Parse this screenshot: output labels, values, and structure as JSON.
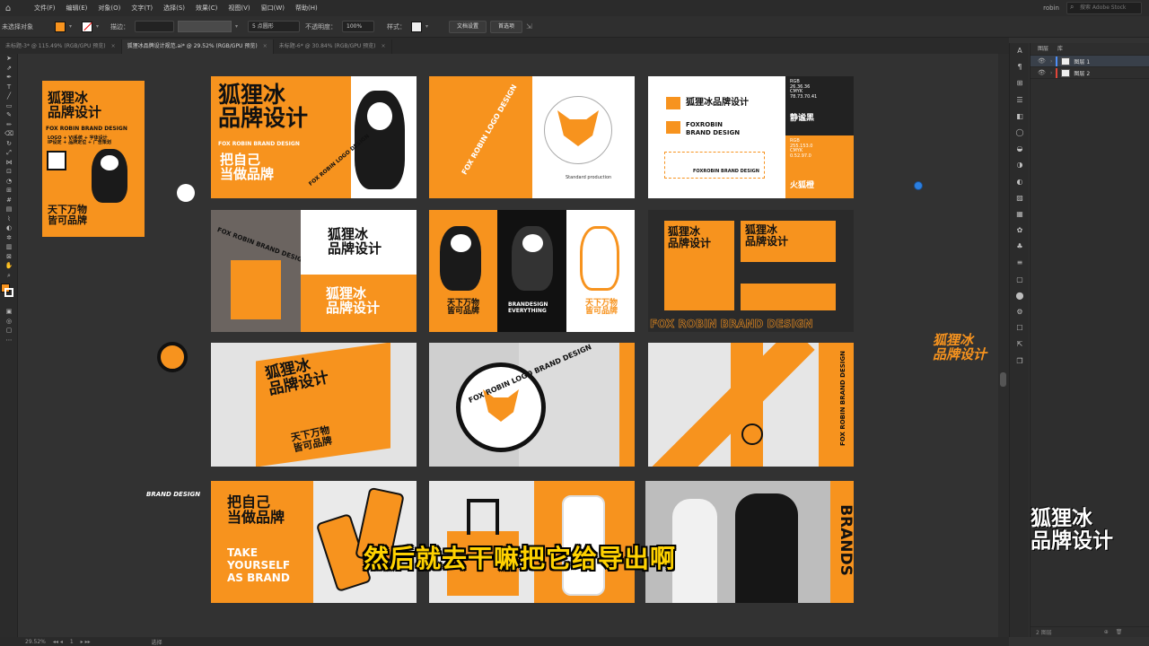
{
  "menubar": {
    "items": [
      "文件(F)",
      "编辑(E)",
      "对象(O)",
      "文字(T)",
      "选择(S)",
      "效果(C)",
      "视图(V)",
      "窗口(W)",
      "帮助(H)"
    ],
    "search_placeholder": "搜索 Adobe Stock",
    "user": "robin"
  },
  "controlbar": {
    "no_selection": "未选择对象",
    "stroke_label": "描边：",
    "stroke_value": "",
    "brush_value": "5 点圆形",
    "opacity_label": "不透明度：",
    "opacity_value": "100%",
    "style_label": "样式：",
    "doc_setup": "文档设置",
    "prefs": "首选项",
    "fill_color": "#f7931e"
  },
  "tabs": [
    {
      "label": "未标题-3* @ 115.49% (RGB/GPU 预览)",
      "active": false
    },
    {
      "label": "狐狸冰品牌设计规范.ai* @ 29.52% (RGB/GPU 预览)",
      "active": true
    },
    {
      "label": "未标题-6* @ 30.84% (RGB/GPU 预览)",
      "active": false
    }
  ],
  "layers_panel": {
    "tab_layers": "图层",
    "tab_libs": "库",
    "layers": [
      {
        "name": "图层 1",
        "color": "#4f8ff7",
        "selected": true
      },
      {
        "name": "图层 2",
        "color": "#e0453a",
        "selected": false
      }
    ],
    "footer_count": "2 图层"
  },
  "status": {
    "zoom": "29.52%",
    "page": "1",
    "tool": "选择"
  },
  "artwork": {
    "poster_title": "狐狸冰\n品牌设计",
    "poster_en": "FOX ROBIN BRAND DESIGN",
    "poster_services": "LOGO + VI系统 + 字体设计\nIP设定 + 品牌定位 + 广告策划",
    "poster_slogan": "天下万物\n皆可品牌",
    "banner_title": "狐狸冰\n品牌设计",
    "banner_en": "FOX ROBIN BRAND DESIGN",
    "banner_slogan": "把自己\n当做品牌",
    "logo_ring_text": "FOX ROBIN LOGO DESIGN",
    "standard": "Standard production",
    "vi_cn": "狐狸冰品牌设计",
    "vi_en1": "FOXROBIN",
    "vi_en2": "BRAND DESIGN",
    "vi_en3": "FOXROBIN BRAND DESIGN",
    "color1_name": "静谧黑",
    "color1_vals": "RGB\n26.36.36\nCMYK\n78.73.70.41",
    "color2_name": "火狐橙",
    "color2_vals": "RGB\n255.153.0\nCMYK\n0.52.97.0",
    "bag_text": "FOX ROBIN BRAND DESIGN",
    "side_cn": "狐狸冰\n品牌设计",
    "char_slogan": "天下万物\n皆可品牌",
    "char_en": "BRANDESIGN\nEVERYTHING",
    "char_slogan2": "天下万物\n皆可品牌",
    "grid_en": "FOX ROBIN BRAND DESIGN",
    "badge_text": "FOX ROBIN LOGO BRAND DESIGN",
    "poster2_title": "狐狸冰\n品牌设计",
    "poster2_slogan": "天下万物\n皆可品牌",
    "tape_en": "FOX ROBIN BRAND DESIGN",
    "brand_design": "BRAND DESIGN",
    "take_title": "把自己\n当做品牌",
    "take_en": "TAKE\nYOURSELF\nAS BRAND",
    "brands": "BRANDS"
  },
  "subtitle": "然后就去干嘛把它给导出啊",
  "watermark": "狐狸冰\n品牌设计",
  "canvas_side_logo": "狐狸冰\n品牌设计"
}
